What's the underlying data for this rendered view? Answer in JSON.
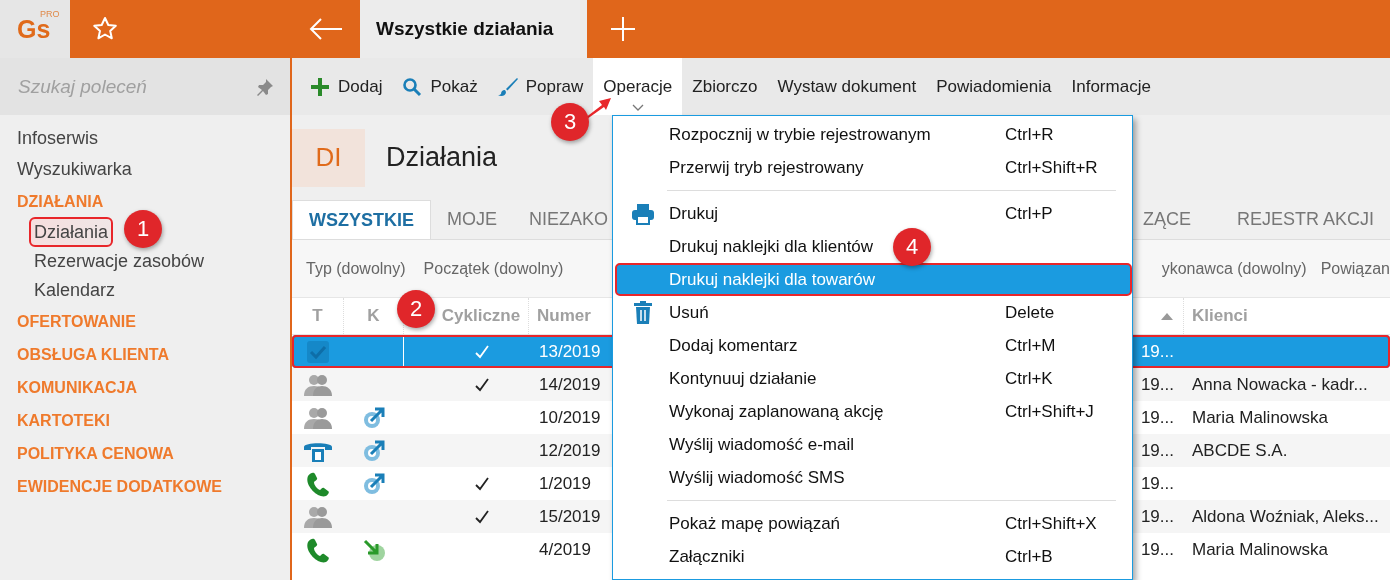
{
  "app": {
    "logo": "Gs",
    "logo_badge": "PRO"
  },
  "tabs": [
    {
      "label": "Wszystkie działania",
      "selected": true
    }
  ],
  "sidebar": {
    "search": {
      "placeholder": "Szukaj poleceń"
    },
    "items": [
      {
        "label": "Infoserwis",
        "kind": "link"
      },
      {
        "label": "Wyszukiwarka",
        "kind": "link"
      },
      {
        "label": "DZIAŁANIA",
        "kind": "section",
        "children": [
          {
            "label": "Działania",
            "selected": true
          },
          {
            "label": "Rezerwacje zasobów",
            "selected": false
          },
          {
            "label": "Kalendarz",
            "selected": false
          }
        ]
      },
      {
        "label": "OFERTOWANIE",
        "kind": "section"
      },
      {
        "label": "OBSŁUGA KLIENTA",
        "kind": "section"
      },
      {
        "label": "KOMUNIKACJA",
        "kind": "section"
      },
      {
        "label": "KARTOTEKI",
        "kind": "section"
      },
      {
        "label": "POLITYKA CENOWA",
        "kind": "section"
      },
      {
        "label": "EWIDENCJE DODATKOWE",
        "kind": "section"
      }
    ]
  },
  "toolbar": [
    {
      "label": "Dodaj",
      "selected": false
    },
    {
      "label": "Pokaż",
      "selected": false
    },
    {
      "label": "Popraw",
      "selected": false
    },
    {
      "label": "Operacje",
      "selected": true
    },
    {
      "label": "Zbiorczo",
      "selected": false
    },
    {
      "label": "Wystaw dokument",
      "selected": false
    },
    {
      "label": "Powiadomienia",
      "selected": false
    },
    {
      "label": "Informacje",
      "selected": false
    }
  ],
  "page": {
    "badge": "DI",
    "title": "Działania"
  },
  "view_tabs": {
    "left": [
      {
        "label": "WSZYSTKIE",
        "selected": true
      },
      {
        "label": "MOJE",
        "selected": false
      },
      {
        "label": "NIEZAKO",
        "selected": false
      }
    ],
    "right": [
      {
        "label": "ZĄCE",
        "selected": false
      },
      {
        "label": "REJESTR AKCJI",
        "selected": false
      }
    ]
  },
  "filters": {
    "left": [
      "Typ (dowolny)",
      "Początek (dowolny)"
    ],
    "right": [
      "ykonawca (dowolny)",
      "Powiązan"
    ]
  },
  "table": {
    "columns": {
      "left": [
        "T",
        "K",
        "Cykliczne",
        "Numer"
      ],
      "right": [
        "Klienci"
      ]
    },
    "rows": [
      {
        "cyclic": true,
        "number": "13/2019",
        "column_5": "19...",
        "selected": true
      },
      {
        "cyclic": true,
        "number": "14/2019",
        "column_5": "19...",
        "client": "Anna Nowacka - kadr...",
        "selected": false
      },
      {
        "cyclic": false,
        "number": "10/2019",
        "column_5": "19...",
        "client": "Maria Malinowska",
        "selected": false
      },
      {
        "cyclic": false,
        "number": "12/2019",
        "column_5": "19...",
        "client": "ABCDE S.A.",
        "selected": false
      },
      {
        "cyclic": true,
        "number": "1/2019",
        "column_5": "19...",
        "selected": false
      },
      {
        "cyclic": true,
        "number": "15/2019",
        "column_5": "19...",
        "client": "Aldona Woźniak, Aleks...",
        "selected": false
      },
      {
        "cyclic": false,
        "number": "4/2019",
        "column_5": "19...",
        "client": "Maria Malinowska",
        "selected": false
      }
    ]
  },
  "menu": {
    "groups": [
      [
        {
          "label": "Rozpocznij w trybie rejestrowanym",
          "shortcut": "Ctrl+R",
          "selected": false
        },
        {
          "label": "Przerwij tryb rejestrowany",
          "shortcut": "Ctrl+Shift+R",
          "selected": false
        }
      ],
      [
        {
          "label": "Drukuj",
          "shortcut": "Ctrl+P",
          "selected": false
        },
        {
          "label": "Drukuj naklejki dla klientów",
          "selected": false
        },
        {
          "label": "Drukuj naklejki dla towarów",
          "selected": true
        },
        {
          "label": "Usuń",
          "shortcut": "Delete",
          "selected": false
        },
        {
          "label": "Dodaj komentarz",
          "shortcut": "Ctrl+M",
          "selected": false
        },
        {
          "label": "Kontynuuj działanie",
          "shortcut": "Ctrl+K",
          "selected": false
        },
        {
          "label": "Wykonaj zaplanowaną akcję",
          "shortcut": "Ctrl+Shift+J",
          "selected": false
        },
        {
          "label": "Wyślij wiadomość e-mail",
          "selected": false
        },
        {
          "label": "Wyślij wiadomość SMS",
          "selected": false
        }
      ],
      [
        {
          "label": "Pokaż mapę powiązań",
          "shortcut": "Ctrl+Shift+X",
          "selected": false
        },
        {
          "label": "Załączniki",
          "shortcut": "Ctrl+B",
          "selected": false
        }
      ]
    ]
  },
  "annotations": [
    {
      "label": "1"
    },
    {
      "label": "2"
    },
    {
      "label": "3"
    },
    {
      "label": "4"
    }
  ]
}
